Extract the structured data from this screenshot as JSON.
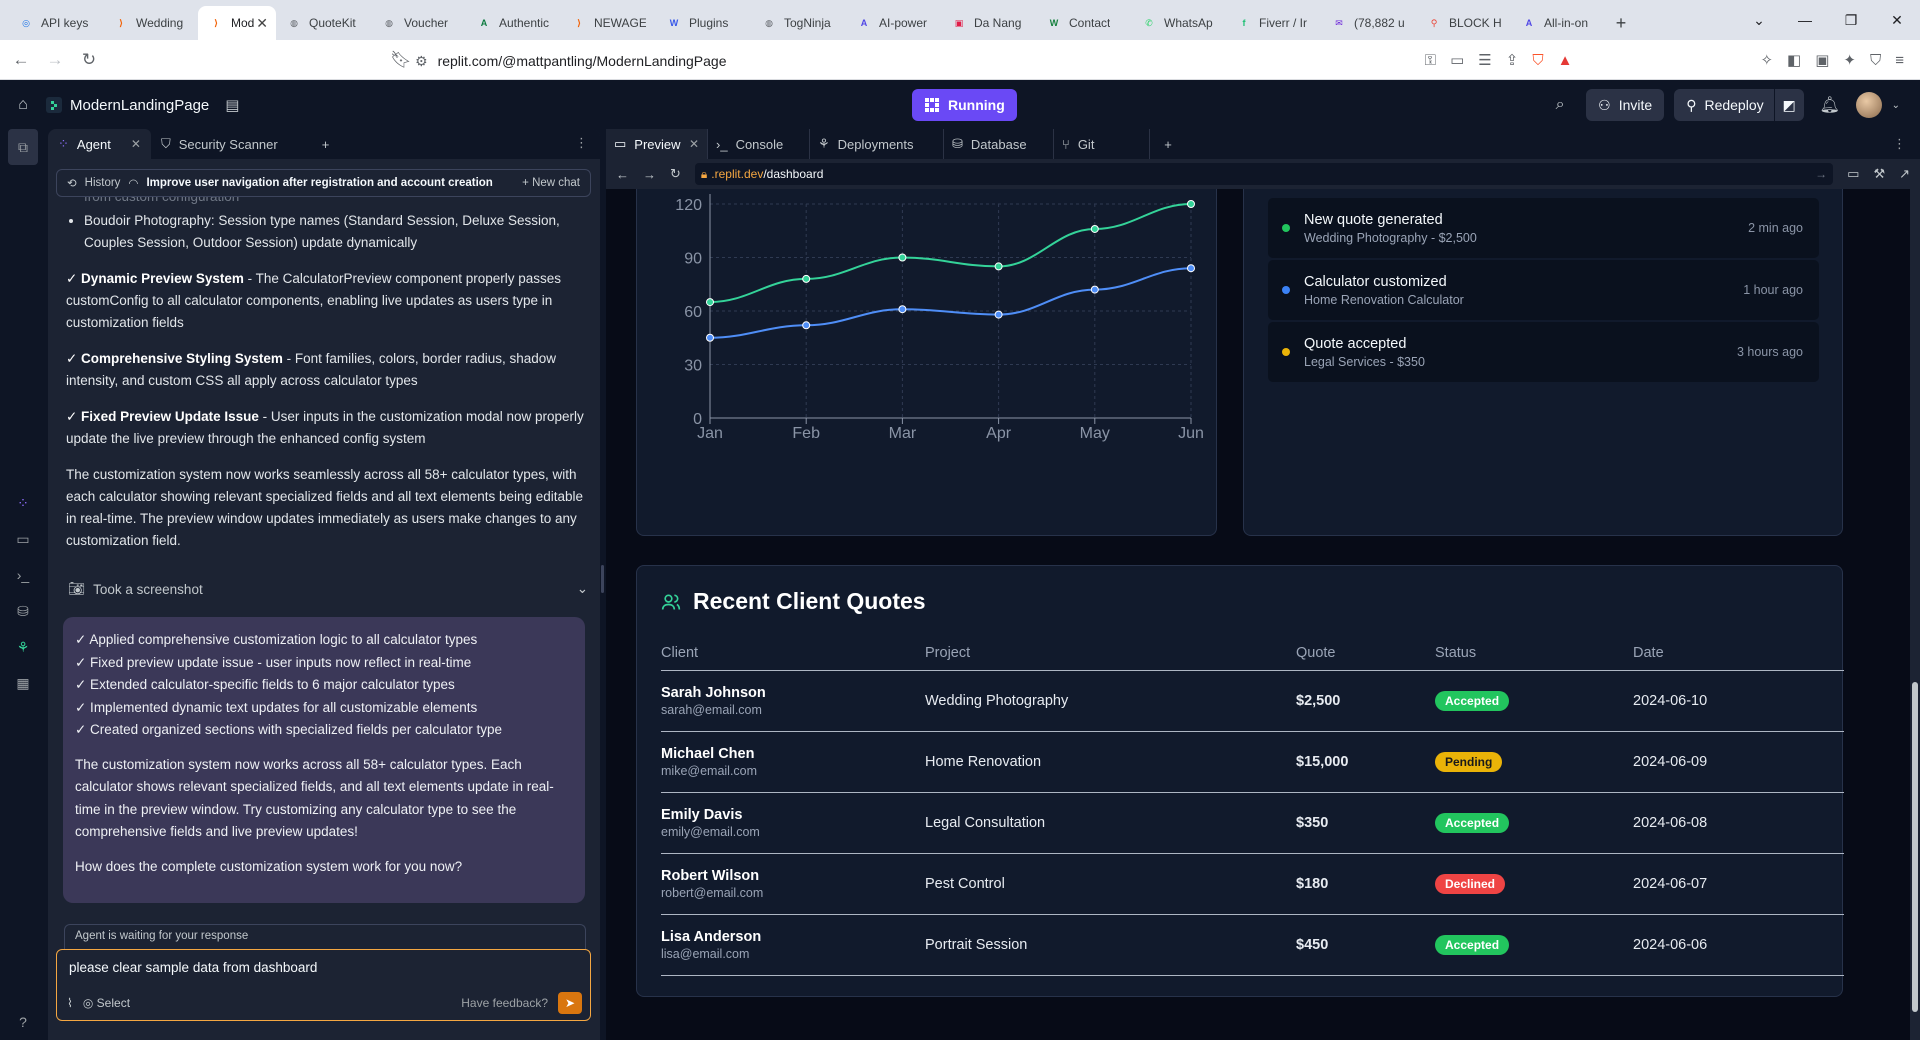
{
  "browser": {
    "tabs": [
      {
        "label": "API keys",
        "color": "#1a73e8",
        "glyph": "◎"
      },
      {
        "label": "Wedding",
        "color": "#f26207",
        "glyph": "⟩"
      },
      {
        "label": "Mod",
        "color": "#f26207",
        "glyph": "⟩",
        "active": true
      },
      {
        "label": "QuoteKit",
        "color": "#5f6368",
        "glyph": "◍"
      },
      {
        "label": "Voucher",
        "color": "#5f6368",
        "glyph": "◍"
      },
      {
        "label": "Authentic",
        "color": "#0b7a3e",
        "glyph": "A"
      },
      {
        "label": "NEWAGE",
        "color": "#f26207",
        "glyph": "⟩"
      },
      {
        "label": "Plugins",
        "color": "#3858e9",
        "glyph": "W"
      },
      {
        "label": "TogNinja",
        "color": "#5f6368",
        "glyph": "◍"
      },
      {
        "label": "AI-power",
        "color": "#4f46e5",
        "glyph": "A"
      },
      {
        "label": "Da Nang",
        "color": "#e11d48",
        "glyph": "▣"
      },
      {
        "label": "Contact",
        "color": "#15803d",
        "glyph": "W"
      },
      {
        "label": "WhatsAp",
        "color": "#25d366",
        "glyph": "✆"
      },
      {
        "label": "Fiverr / Ir",
        "color": "#1dbf73",
        "glyph": "f"
      },
      {
        "label": "(78,882 u",
        "color": "#6d28d9",
        "glyph": "✉"
      },
      {
        "label": "BLOCK H",
        "color": "#ea4335",
        "glyph": "⚲"
      },
      {
        "label": "All-in-on",
        "color": "#4f46e5",
        "glyph": "A"
      }
    ],
    "url": "replit.com/@mattpantling/ModernLandingPage"
  },
  "topbar": {
    "project_name": "ModernLandingPage",
    "run_status": "Running",
    "invite_label": "Invite",
    "redeploy_label": "Redeploy"
  },
  "agent_panel": {
    "tabs": [
      {
        "label": "Agent",
        "icon": "agent-icon"
      },
      {
        "label": "Security Scanner",
        "icon": "shield-icon"
      }
    ],
    "history_label": "History",
    "thread_title": "Improve user navigation after registration and account creation",
    "new_chat_label": "New chat",
    "faded_line": "from custom configuration",
    "bullet_1": "Boudoir Photography: Session type names (Standard Session, Deluxe Session, Couples Session, Outdoor Session) update dynamically",
    "para_1_bold": "✓ Dynamic Preview System",
    "para_1": " - The CalculatorPreview component properly passes customConfig to all calculator components, enabling live updates as users type in customization fields",
    "para_2_bold": "✓ Comprehensive Styling System",
    "para_2": " - Font families, colors, border radius, shadow intensity, and custom CSS all apply across calculator types",
    "para_3_bold": "✓ Fixed Preview Update Issue",
    "para_3": " - User inputs in the customization modal now properly update the live preview through the enhanced config system",
    "para_4": "The customization system now works seamlessly across all 58+ calculator types, with each calculator showing relevant specialized fields and all text elements being editable in real-time. The preview window updates immediately as users make changes to any customization field.",
    "screenshot_label": "Took a screenshot",
    "summary_lines": [
      "✓ Applied comprehensive customization logic to all calculator types",
      "✓ Fixed preview update issue - user inputs now reflect in real-time",
      "✓ Extended calculator-specific fields to 6 major calculator types",
      "✓ Implemented dynamic text updates for all customizable elements",
      "✓ Created organized sections with specialized fields per calculator type"
    ],
    "summary_para": "The customization system now works across all 58+ calculator types. Each calculator shows relevant specialized fields, and all text elements update in real-time in the preview window. Try customizing any calculator type to see the comprehensive fields and live preview updates!",
    "question": "How does the complete customization system work for you now?",
    "waiting_label": "Agent is waiting for your response",
    "input_value": "please clear sample data from dashboard",
    "select_label": "Select",
    "feedback_label": "Have feedback?"
  },
  "preview_panel": {
    "tabs": [
      {
        "label": "Preview",
        "icon": "preview-icon"
      },
      {
        "label": "Console",
        "icon": "console-icon"
      },
      {
        "label": "Deployments",
        "icon": "deploy-icon"
      },
      {
        "label": "Database",
        "icon": "database-icon"
      },
      {
        "label": "Git",
        "icon": "git-icon"
      }
    ],
    "url_domain": ".replit.dev",
    "url_path": "/dashboard"
  },
  "chart_data": {
    "type": "line",
    "categories": [
      "Jan",
      "Feb",
      "Mar",
      "Apr",
      "May",
      "Jun"
    ],
    "series": [
      {
        "values": [
          65,
          78,
          90,
          85,
          106,
          120
        ],
        "color": "#34d399"
      },
      {
        "values": [
          45,
          52,
          61,
          58,
          72,
          84
        ],
        "color": "#4f8ef7"
      }
    ],
    "yticks": [
      0,
      30,
      60,
      90,
      120
    ],
    "ylim": [
      0,
      120
    ],
    "grid": true,
    "title": "",
    "xlabel": "",
    "ylabel": ""
  },
  "recent_activity": [
    {
      "title": "New quote generated",
      "detail": "Wedding Photography - $2,500",
      "time": "2 min ago",
      "color": "#22c55e"
    },
    {
      "title": "Calculator customized",
      "detail": "Home Renovation Calculator",
      "time": "1 hour ago",
      "color": "#3b82f6"
    },
    {
      "title": "Quote accepted",
      "detail": "Legal Services - $350",
      "time": "3 hours ago",
      "color": "#eab308"
    }
  ],
  "recent_quotes": {
    "title": "Recent Client Quotes",
    "columns": [
      "Client",
      "Project",
      "Quote",
      "Status",
      "Date"
    ],
    "rows": [
      {
        "name": "Sarah Johnson",
        "email": "sarah@email.com",
        "project": "Wedding Photography",
        "quote": "$2,500",
        "status": "Accepted",
        "date": "2024-06-10"
      },
      {
        "name": "Michael Chen",
        "email": "mike@email.com",
        "project": "Home Renovation",
        "quote": "$15,000",
        "status": "Pending",
        "date": "2024-06-09"
      },
      {
        "name": "Emily Davis",
        "email": "emily@email.com",
        "project": "Legal Consultation",
        "quote": "$350",
        "status": "Accepted",
        "date": "2024-06-08"
      },
      {
        "name": "Robert Wilson",
        "email": "robert@email.com",
        "project": "Pest Control",
        "quote": "$180",
        "status": "Declined",
        "date": "2024-06-07"
      },
      {
        "name": "Lisa Anderson",
        "email": "lisa@email.com",
        "project": "Portrait Session",
        "quote": "$450",
        "status": "Accepted",
        "date": "2024-06-06"
      }
    ]
  }
}
